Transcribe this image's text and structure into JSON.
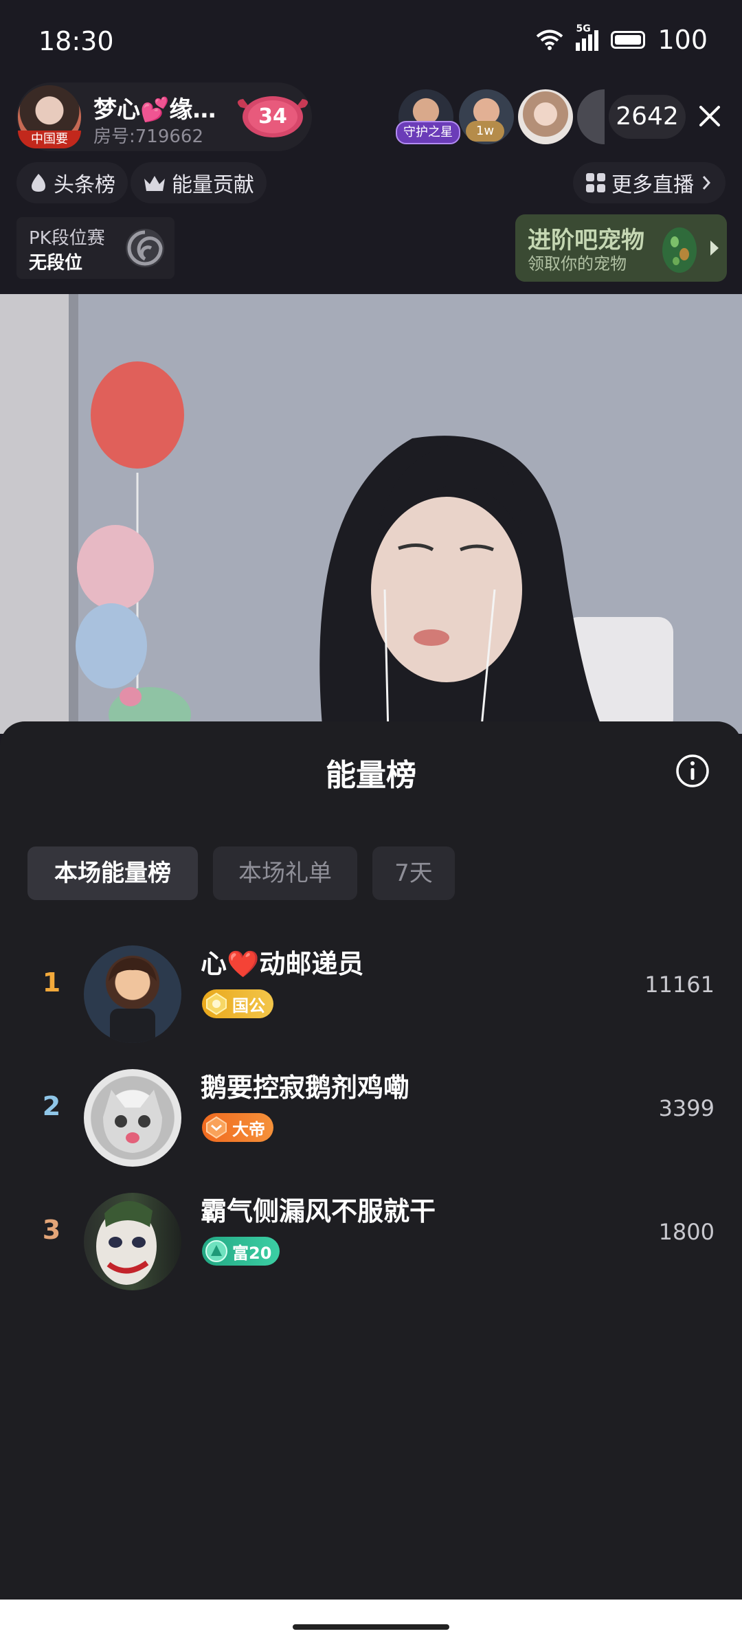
{
  "status_bar": {
    "time": "18:30",
    "network": "5G",
    "battery": "100"
  },
  "header": {
    "anchor_name": "梦心💕缘…",
    "room_number": "房号:719662",
    "anchor_tag": "中国要",
    "heart_count": "34",
    "viewer_tags": [
      "守护之星",
      "1w"
    ],
    "viewer_count": "2642"
  },
  "subrow": {
    "hot_list": "头条榜",
    "energy_contrib": "能量贡献",
    "more_live": "更多直播"
  },
  "pk": {
    "title": "PK段位赛",
    "rank": "无段位"
  },
  "pet_banner": {
    "title": "进阶吧宠物",
    "subtitle": "领取你的宠物"
  },
  "sheet": {
    "title": "能量榜",
    "tabs": [
      {
        "label": "本场能量榜",
        "active": true
      },
      {
        "label": "本场礼单",
        "active": false
      },
      {
        "label": "7天",
        "active": false
      }
    ],
    "ranking": [
      {
        "rank": "1",
        "name": "心❤️动邮递员",
        "badge": "国公",
        "score": "11161"
      },
      {
        "rank": "2",
        "name": "鹅要控寂鹅剂鸡嘞",
        "badge": "大帝",
        "score": "3399"
      },
      {
        "rank": "3",
        "name": "霸气侧漏风不服就干",
        "badge": "富20",
        "score": "1800"
      }
    ]
  },
  "colors": {
    "rank1": "#f2a93b",
    "rank2": "#8fc6e8",
    "rank3": "#e3a578",
    "badge_gold": "#e9a81c",
    "badge_orange": "#f27a1f",
    "badge_green": "#2fbf95"
  }
}
